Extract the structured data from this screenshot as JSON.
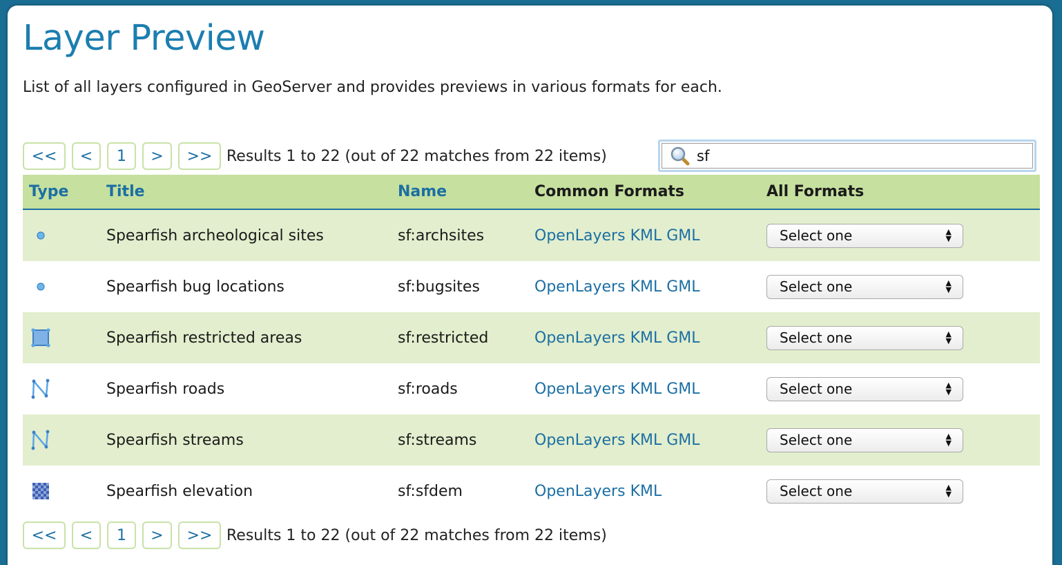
{
  "page": {
    "title": "Layer Preview",
    "description": "List of all layers configured in GeoServer and provides previews in various formats for each."
  },
  "pager": {
    "first": "<<",
    "prev": "<",
    "page": "1",
    "next": ">",
    "last": ">>",
    "results": "Results 1 to 22 (out of 22 matches from 22 items)"
  },
  "search": {
    "value": "sf"
  },
  "table": {
    "headers": {
      "type": "Type",
      "title": "Title",
      "name": "Name",
      "common_formats": "Common Formats",
      "all_formats": "All Formats"
    },
    "rows": [
      {
        "type_icon": "point-icon",
        "title": "Spearfish archeological sites",
        "name": "sf:archsites",
        "formats": [
          "OpenLayers",
          "KML",
          "GML"
        ],
        "select": "Select one"
      },
      {
        "type_icon": "point-icon",
        "title": "Spearfish bug locations",
        "name": "sf:bugsites",
        "formats": [
          "OpenLayers",
          "KML",
          "GML"
        ],
        "select": "Select one"
      },
      {
        "type_icon": "polygon-icon",
        "title": "Spearfish restricted areas",
        "name": "sf:restricted",
        "formats": [
          "OpenLayers",
          "KML",
          "GML"
        ],
        "select": "Select one"
      },
      {
        "type_icon": "line-icon",
        "title": "Spearfish roads",
        "name": "sf:roads",
        "formats": [
          "OpenLayers",
          "KML",
          "GML"
        ],
        "select": "Select one"
      },
      {
        "type_icon": "line-icon",
        "title": "Spearfish streams",
        "name": "sf:streams",
        "formats": [
          "OpenLayers",
          "KML",
          "GML"
        ],
        "select": "Select one"
      },
      {
        "type_icon": "raster-icon",
        "title": "Spearfish elevation",
        "name": "sf:sfdem",
        "formats": [
          "OpenLayers",
          "KML"
        ],
        "select": "Select one"
      }
    ]
  },
  "colors": {
    "title_blue": "#1c7eb0",
    "link_blue": "#1c6fa3",
    "header_green": "#c6e09f",
    "row_green": "#e2eecd"
  }
}
